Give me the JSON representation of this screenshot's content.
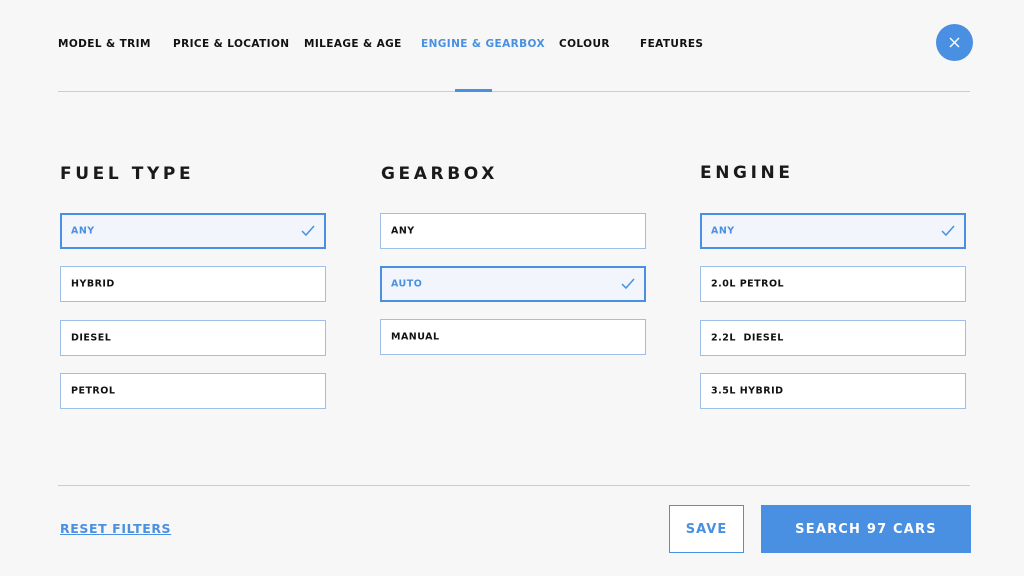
{
  "tabs": [
    {
      "label": "MODEL & TRIM"
    },
    {
      "label": "PRICE & LOCATION"
    },
    {
      "label": "MILEAGE & AGE"
    },
    {
      "label": "ENGINE & GEARBOX",
      "active": true
    },
    {
      "label": "COLOUR"
    },
    {
      "label": "FEATURES"
    }
  ],
  "close": {
    "icon": "close-icon"
  },
  "sections": {
    "fuel": {
      "title": "FUEL TYPE",
      "options": [
        {
          "label": "ANY",
          "selected": true
        },
        {
          "label": "HYBRID",
          "selected": false
        },
        {
          "label": "DIESEL",
          "selected": false
        },
        {
          "label": "PETROL",
          "selected": false
        }
      ]
    },
    "gearbox": {
      "title": "GEARBOX",
      "options": [
        {
          "label": "ANY",
          "selected": false
        },
        {
          "label": "AUTO",
          "selected": true
        },
        {
          "label": "MANUAL",
          "selected": false
        }
      ]
    },
    "engine": {
      "title": "ENGINE",
      "options": [
        {
          "label": "ANY",
          "selected": true
        },
        {
          "label": "2.0L PETROL",
          "selected": false
        },
        {
          "label": "2.2L  DIESEL",
          "selected": false
        },
        {
          "label": "3.5L HYBRID",
          "selected": false
        }
      ]
    }
  },
  "footer": {
    "reset_label": "RESET FILTERS",
    "save_label": "SAVE",
    "search_label": "SEARCH 97 CARS"
  },
  "colors": {
    "accent": "#4a90e2",
    "border": "#9dbfe8",
    "background": "#f7f7f7"
  }
}
